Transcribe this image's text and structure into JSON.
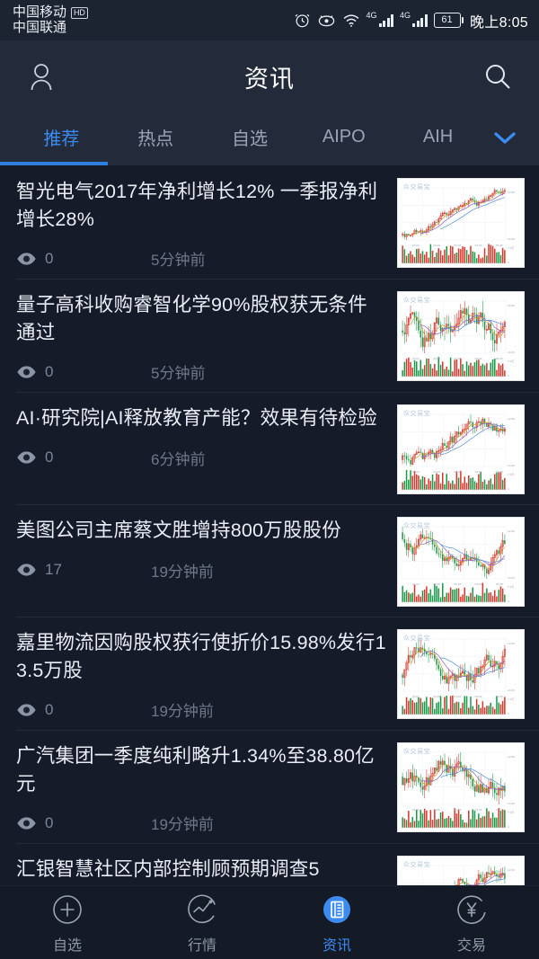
{
  "status_bar": {
    "carrier_primary": "中国移动",
    "carrier_badge": "HD",
    "carrier_secondary": "中国联通",
    "battery_percent": "61",
    "clock": "晚上8:05",
    "icons": [
      "alarm-icon",
      "eye-care-icon",
      "wifi-icon",
      "signal-4g-icon",
      "signal-4g-secondary-icon",
      "battery-icon"
    ],
    "network_label": "4G"
  },
  "header": {
    "title": "资讯",
    "profile_icon": "person-icon",
    "search_icon": "search-icon"
  },
  "tabs": {
    "items": [
      {
        "label": "推荐",
        "active": true
      },
      {
        "label": "热点",
        "active": false
      },
      {
        "label": "自选",
        "active": false
      },
      {
        "label": "AIPO",
        "active": false
      },
      {
        "label": "AIH",
        "active": false
      }
    ],
    "expand_icon": "chevron-down-icon",
    "active_color": "#3b8bf0",
    "inactive_color": "#9aa4b4"
  },
  "progress": {
    "percent": 20,
    "color": "#2f7fe0"
  },
  "news": {
    "view_icon": "eye-icon",
    "items": [
      {
        "title": "智光电气2017年净利增长12%  一季报净利增长28%",
        "views": "0",
        "time": "5分钟前",
        "thumbnail_watermark": "众交易宝"
      },
      {
        "title": "量子高科收购睿智化学90%股权获无条件通过",
        "views": "0",
        "time": "5分钟前",
        "thumbnail_watermark": "众交易宝"
      },
      {
        "title": "AI·研究院|AI释放教育产能？效果有待检验",
        "views": "0",
        "time": "6分钟前",
        "thumbnail_watermark": "众交易宝"
      },
      {
        "title": "美图公司主席蔡文胜增持800万股股份",
        "views": "17",
        "time": "19分钟前",
        "thumbnail_watermark": "众交易宝"
      },
      {
        "title": "嘉里物流因购股权获行使折价15.98%发行13.5万股",
        "views": "0",
        "time": "19分钟前",
        "thumbnail_watermark": "众交易宝"
      },
      {
        "title": "广汽集团一季度纯利略升1.34%至38.80亿元",
        "views": "0",
        "time": "19分钟前",
        "thumbnail_watermark": "众交易宝"
      },
      {
        "title": "汇银智慧社区内部控制顾预期调查5",
        "views": "",
        "time": "",
        "thumbnail_watermark": "众交易宝"
      }
    ]
  },
  "bottom_nav": {
    "items": [
      {
        "label": "自选",
        "icon": "plus-circle-icon",
        "active": false
      },
      {
        "label": "行情",
        "icon": "chart-circle-icon",
        "active": false
      },
      {
        "label": "资讯",
        "icon": "news-document-icon",
        "active": true
      },
      {
        "label": "交易",
        "icon": "yen-circle-icon",
        "active": false
      }
    ],
    "active_color": "#3b8bf0"
  }
}
